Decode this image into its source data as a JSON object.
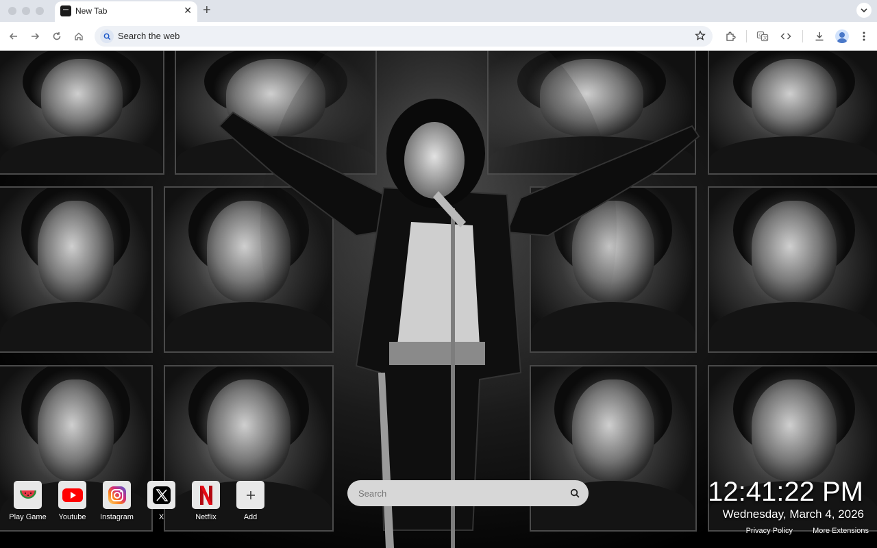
{
  "browser": {
    "tab_title": "New Tab",
    "omnibox_text": "Search the web",
    "icons": [
      "back-icon",
      "forward-icon",
      "reload-icon",
      "home-icon",
      "star-icon",
      "extensions-icon",
      "translate-icon",
      "code-icon",
      "download-icon",
      "profile-icon",
      "menu-icon"
    ]
  },
  "shortcuts": [
    {
      "label": "Play Game",
      "icon": "watermelon-icon"
    },
    {
      "label": "Youtube",
      "icon": "youtube-icon"
    },
    {
      "label": "Instagram",
      "icon": "instagram-icon"
    },
    {
      "label": "X",
      "icon": "x-icon"
    },
    {
      "label": "Netflix",
      "icon": "netflix-icon"
    },
    {
      "label": "Add",
      "icon": "plus-icon"
    }
  ],
  "search": {
    "placeholder": "Search"
  },
  "clock": {
    "time": "12:41:22 PM",
    "date": "Wednesday, March 4, 2026"
  },
  "footer": {
    "privacy": "Privacy Policy",
    "more": "More Extensions"
  },
  "colors": {
    "youtube": "#ff0000",
    "netflix": "#e50914",
    "search_bg": "#d7d7d7"
  }
}
